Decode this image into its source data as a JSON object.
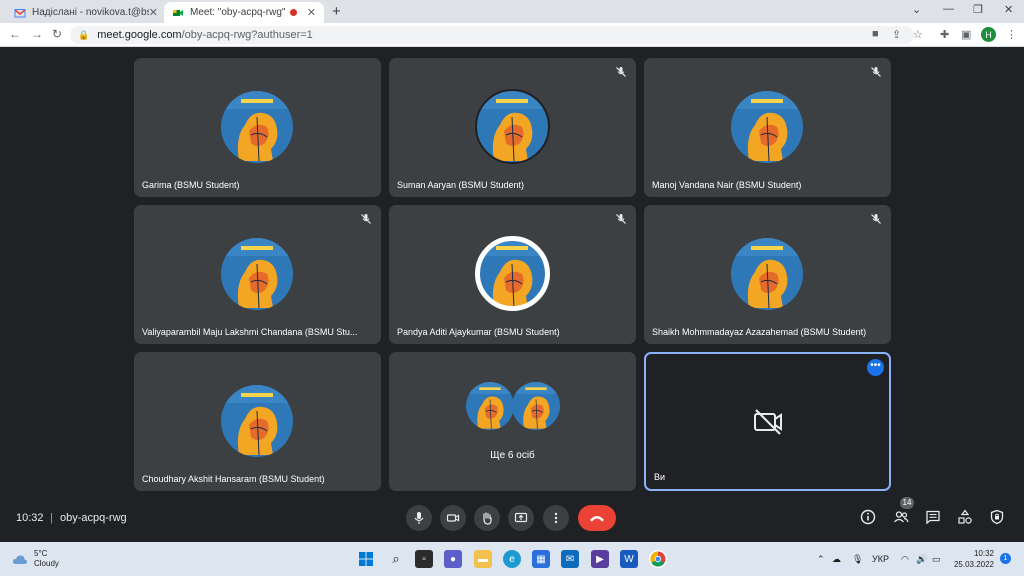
{
  "browser": {
    "tabs": [
      {
        "title": "Надіслані - novikova.t@bsmu.edu.ua",
        "icon": "gmail-icon"
      },
      {
        "title": "Meet: \"oby-acpq-rwg\"",
        "icon": "meet-icon"
      }
    ],
    "new_tab": "+",
    "url_host": "meet.google.com",
    "url_path": "/oby-acpq-rwg?authuser=1",
    "profile_initial": "H"
  },
  "participants": [
    {
      "name": "Garima (BSMU Student)",
      "muted": false
    },
    {
      "name": "Suman Aaryan (BSMU Student)",
      "muted": true
    },
    {
      "name": "Manoj Vandana Nair (BSMU Student)",
      "muted": true
    },
    {
      "name": "Valiyaparambil Maju Lakshmi Chandana (BSMU Stu...",
      "muted": true
    },
    {
      "name": "Pandya Aditi Ajaykumar (BSMU Student)",
      "muted": true
    },
    {
      "name": "Shaikh Mohmmadayaz Azazahemad (BSMU Student)",
      "muted": true
    },
    {
      "name": "Choudhary Akshit Hansaram (BSMU Student)",
      "muted": false
    }
  ],
  "more_tile": {
    "label": "Ще 6 осіб"
  },
  "self_tile": {
    "name": "Ви",
    "menu": "•••"
  },
  "meeting": {
    "time": "10:32",
    "separator": "|",
    "code": "oby-acpq-rwg",
    "people_count": "14"
  },
  "taskbar": {
    "weather_temp": "5°C",
    "weather_desc": "Cloudy",
    "lang": "УКР",
    "time": "10:32",
    "date": "25.03.2022",
    "notifications": "1"
  },
  "colors": {
    "meet_bg": "#202124",
    "tile_bg": "#3c4043",
    "end_call": "#ea4335",
    "accent": "#8ab4f8"
  }
}
